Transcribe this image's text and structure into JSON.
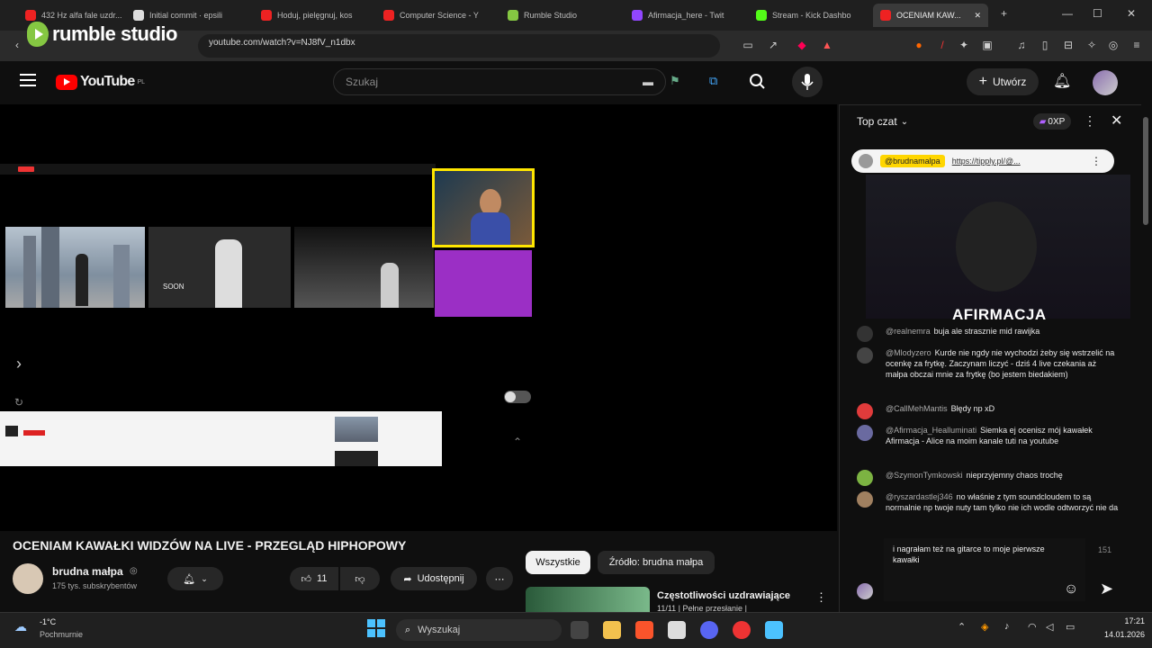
{
  "browser": {
    "tabs": [
      {
        "label": "432 Hz alfa fale uzdr...",
        "color": "#e22"
      },
      {
        "label": "Initial commit · epsili",
        "color": "#ddd"
      },
      {
        "label": "Hoduj, pielęgnuj, kos",
        "color": "#e22"
      },
      {
        "label": "Computer Science - Y",
        "color": "#e22"
      },
      {
        "label": "Rumble Studio",
        "color": "#85c742"
      },
      {
        "label": "Afirmacja_here - Twit",
        "color": "#9146ff"
      },
      {
        "label": "Stream - Kick Dashbo",
        "color": "#53fc18"
      },
      {
        "label": "OCENIAM KAW...",
        "color": "#e22"
      }
    ],
    "url": "youtube.com/watch?v=NJ8fV_n1dbx",
    "new_tab": "+",
    "minimize": "—",
    "maximize": "☐",
    "close": "✕"
  },
  "watermark": {
    "brand": "rumble studio"
  },
  "youtube": {
    "logo_text": "YouTube",
    "logo_region": "PL",
    "search_placeholder": "Szukaj",
    "create_label": "Utwórz"
  },
  "video": {
    "title": "OCENIAM KAWAŁKI WIDZÓW NA LIVE - PRZEGLĄD HIPHOPOWY",
    "channel": "brudna małpa",
    "subscribers": "175 tys. subskrybentów",
    "likes": "11",
    "share_label": "Udostępnij",
    "filter_all": "Wszystkie",
    "filter_source": "Źródło: brudna małpa",
    "next_video_title": "Częstotliwości uzdrawiające",
    "next_video_sub": "11/11 | Pełne przesłanie |",
    "inner_thumb_text": "SOON"
  },
  "chat": {
    "header": "Top czat",
    "points": "0XP",
    "pinned_user": "@brudnamalpa",
    "pinned_link": "https://tipply.pl/@...",
    "overlay_text": "AFIRMACJA",
    "messages": [
      {
        "author": "@realnemra",
        "text": "buja ale strasznie mid rawijka",
        "color": "#333"
      },
      {
        "author": "@Mlodyzero",
        "text": "Kurde nie ngdy nie wychodzi żeby się wstrzelić na ocenkę za frytkę. Zaczynam liczyć - dziś 4 live czekania aż małpa obczai mnie za frytkę (bo jestem biedakiem)",
        "color": "#444"
      },
      {
        "author": "@CallMehMantis",
        "text": "Błędy np xD",
        "color": "#e03b3b"
      },
      {
        "author": "@Afirmacja_Healluminati",
        "text": "Siemka ej ocenisz mój kawałek Afirmacja - Alice na moim kanale tuti na youtube",
        "color": "#6a6aa0"
      },
      {
        "author": "@SzymonTymkowski",
        "text": "nieprzyjemny chaos trochę",
        "color": "#7cb342"
      },
      {
        "author": "@ryszardastlej346",
        "text": "no właśnie z tym soundcloudem to są normalnie np twoje nuty tam tylko nie ich wodle odtworzyć nie da",
        "color": "#a08060"
      }
    ],
    "input_value": "i nagrałam też na gitarce to moje pierwsze kawałki",
    "char_count": "151"
  },
  "taskbar": {
    "weather_temp": "-1°C",
    "weather_desc": "Pochmurnie",
    "search_label": "Wyszukaj",
    "time": "17:21",
    "date": "14.01.2026"
  }
}
